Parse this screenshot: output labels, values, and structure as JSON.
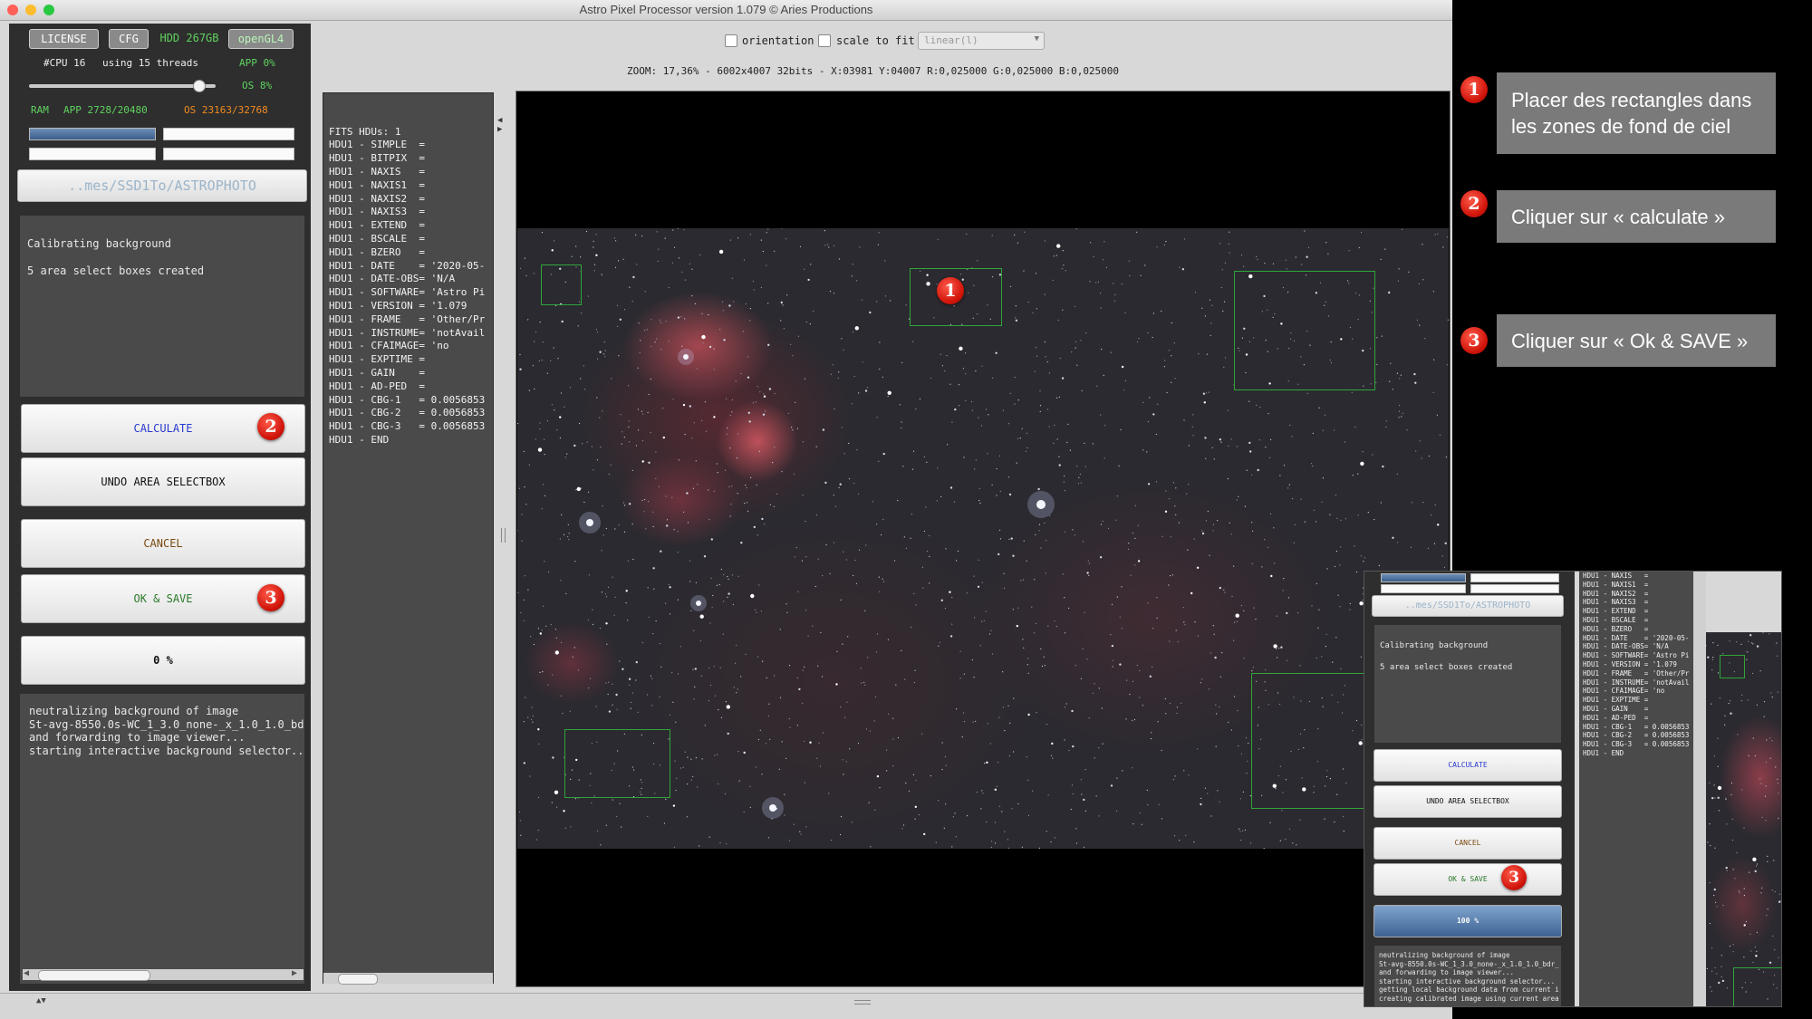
{
  "window": {
    "title": "Astro Pixel Processor version 1.079 © Aries Productions"
  },
  "top_buttons": {
    "license": "LICENSE",
    "cfg": "CFG",
    "hdd": "HDD 267GB",
    "opengl": "openGL4"
  },
  "system": {
    "cpu": "#CPU 16",
    "threads": "using 15 threads",
    "app_cpu": "APP 0%",
    "os_cpu": "OS 8%",
    "ram_label": "RAM",
    "ram_app": "APP 2728/20480",
    "ram_os": "OS 23163/32768"
  },
  "path": "..mes/SSD1To/ASTROPHOTO",
  "status": {
    "line1": "Calibrating background",
    "line2": "5 area select boxes created"
  },
  "buttons": {
    "calculate": "CALCULATE",
    "undo": "UNDO AREA SELECTBOX",
    "cancel": "CANCEL",
    "ok_save": "OK & SAVE",
    "progress": "0 %"
  },
  "log": {
    "text": "neutralizing background of image\nSt-avg-8550.0s-WC_1_3.0_none-_x_1.0_1.0_bdr_\nand forwarding to image viewer...\nstarting interactive background selector..."
  },
  "fits": {
    "text": "FITS HDUs: 1\nHDU1 - SIMPLE  =\nHDU1 - BITPIX  =\nHDU1 - NAXIS   =\nHDU1 - NAXIS1  =\nHDU1 - NAXIS2  =\nHDU1 - NAXIS3  =\nHDU1 - EXTEND  =\nHDU1 - BSCALE  =\nHDU1 - BZERO   =\nHDU1 - DATE    = '2020-05-\nHDU1 - DATE-OBS= 'N/A\nHDU1 - SOFTWARE= 'Astro Pi\nHDU1 - VERSION = '1.079\nHDU1 - FRAME   = 'Other/Pr\nHDU1 - INSTRUME= 'notAvail\nHDU1 - CFAIMAGE= 'no\nHDU1 - EXPTIME =\nHDU1 - GAIN    =\nHDU1 - AD-PED  =\nHDU1 - CBG-1   = 0.0056853\nHDU1 - CBG-2   = 0.0056853\nHDU1 - CBG-3   = 0.0056853\nHDU1 - END"
  },
  "viewer": {
    "orientation_label": "orientation",
    "scale_label": "scale to fit",
    "stretch_value": "linear(l)",
    "zoom_info": "ZOOM: 17,36% - 6002x4007 32bits - X:03981 Y:04007 R:0,025000 G:0,025000 B:0,025000"
  },
  "markers": {
    "m1": "1",
    "m2": "2",
    "m3": "3"
  },
  "annotations": {
    "step1": "Placer des rectangles dans les zones de fond de ciel",
    "step2": "Cliquer sur « calculate »",
    "step3": "Cliquer sur « Ok & SAVE »"
  },
  "inset": {
    "path": "..mes/SSD1To/ASTROPHOTO",
    "status_line1": "Calibrating background",
    "status_line2": "5 area select boxes created",
    "calculate": "CALCULATE",
    "undo": "UNDO AREA SELECTBOX",
    "cancel": "CANCEL",
    "ok_save": "OK & SAVE",
    "progress": "100 %",
    "log": "neutralizing background of image\nSt-avg-8550.0s-WC_1_3.0_none-_x_1.0_1.0_bdr_\nand forwarding to image viewer...\nstarting interactive background selector...\ngetting local background data from current i\ncreating calibrated image using current area",
    "fits": "HDU1 - NAXIS   =\nHDU1 - NAXIS1  =\nHDU1 - NAXIS2  =\nHDU1 - NAXIS3  =\nHDU1 - EXTEND  =\nHDU1 - BSCALE  =\nHDU1 - BZERO   =\nHDU1 - DATE    = '2020-05-\nHDU1 - DATE-OBS= 'N/A\nHDU1 - SOFTWARE= 'Astro Pi\nHDU1 - VERSION = '1.079\nHDU1 - FRAME   = 'Other/Pr\nHDU1 - INSTRUME= 'notAvail\nHDU1 - CFAIMAGE= 'no\nHDU1 - EXPTIME =\nHDU1 - GAIN    =\nHDU1 - AD-PED  =\nHDU1 - CBG-1   = 0.0056853\nHDU1 - CBG-2   = 0.0056853\nHDU1 - CBG-3   = 0.0056853\nHDU1 - END"
  },
  "colors": {
    "accent_blue": "#2a3ad0",
    "ok_green": "#2a7a2a",
    "cancel_brown": "#7a4a10",
    "ram_green": "#22a022",
    "os_orange": "#e07a10",
    "selection_green": "#2fa53a",
    "marker_red": "#d0140a"
  }
}
